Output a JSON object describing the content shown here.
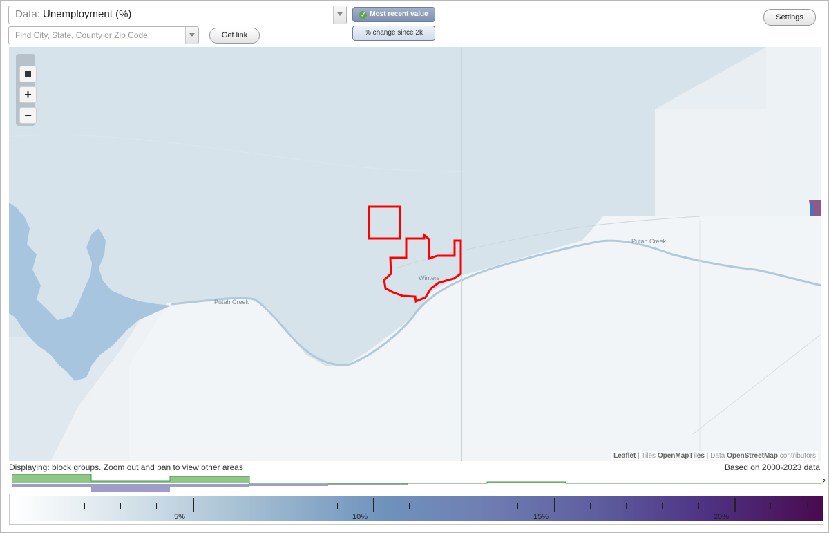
{
  "controls": {
    "data_prefix": "Data:",
    "data_value": "Unemployment (%)",
    "search_placeholder": "Find City, State, County or Zip Code",
    "get_link_label": "Get link",
    "settings_label": "Settings",
    "mode_recent_label": "Most recent value",
    "mode_change_label": "% change since 2k",
    "active_mode": "Most recent value"
  },
  "map": {
    "creek_label_1": "Putah Creek",
    "creek_label_2": "Putah Creek",
    "city_label": "Winters",
    "attribution": {
      "leaflet": "Leaflet",
      "sep1": " | Tiles ",
      "tiles": "OpenMapTiles",
      "sep2": " | Data ",
      "osm": "OpenStreetMap",
      "contrib": " contributors"
    },
    "zoom_in_label": "+",
    "zoom_out_label": "−",
    "boundary_color": "#ff0000"
  },
  "footer": {
    "displaying": "Displaying: block groups. Zoom out and pan to view other areas",
    "based_on": "Based on 2000-2023 data",
    "histogram_marker": "?"
  },
  "legend": {
    "labels": [
      "5%",
      "10%",
      "15%",
      "20%"
    ],
    "min": 0,
    "max": 22.5,
    "minor_step": 1,
    "colors": [
      "#ffffff",
      "#a7c1d4",
      "#6f92bd",
      "#5e5ea0",
      "#4a0a4e"
    ]
  }
}
